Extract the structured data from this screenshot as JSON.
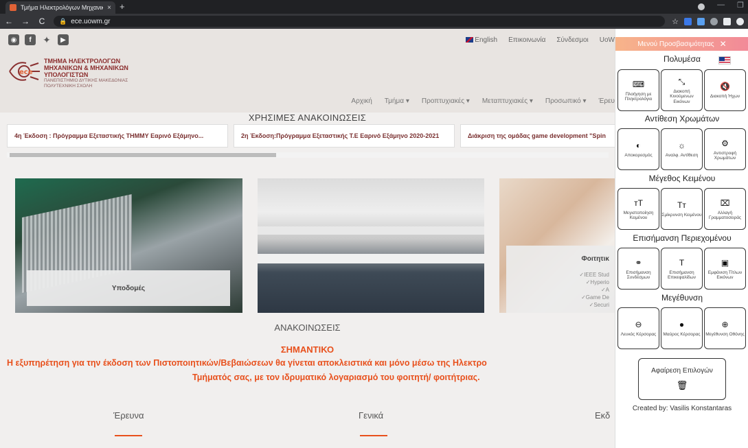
{
  "browser": {
    "tab_title": "Τμήμα Ηλεκτρολόγων Μηχανικ...",
    "tab_close": "×",
    "new_tab": "+",
    "url": "ece.uowm.gr",
    "back": "←",
    "forward": "→",
    "reload": "C"
  },
  "site": {
    "top_links": [
      "English",
      "Επικοινωνία",
      "Σύνδεσμοι",
      "UoW"
    ],
    "logo_lines": [
      "ΤΜΗΜΑ ΗΛΕΚΤΡΟΛΟΓΩΝ",
      "ΜΗΧΑΝΙΚΩΝ & ΜΗΧΑΝΙΚΩΝ",
      "ΥΠΟΛΟΓΙΣΤΩΝ"
    ],
    "logo_sub": [
      "ΠΑΝΕΠΙΣΤΗΜΙΟ ΔΥΤΙΚΗΣ ΜΑΚΕΔΟΝΙΑΣ",
      "ΠΟΛΥΤΕΧΝΙΚΗ ΣΧΟΛΗ"
    ],
    "nav": [
      "Αρχική",
      "Τμήμα ▾",
      "Προπτυχιακές ▾",
      "Μεταπτυχιακές ▾",
      "Προσωπικό ▾",
      "Έρευ"
    ],
    "useful_title": "ΧΡΗΣΙΜΕΣ ΑΝΑΚΟΙΝΩΣΕΙΣ",
    "cards": [
      "4η Έκδοση : Πρόγραμμα Εξεταστικής ΤΗΜΜΥ Εαρινό Εξάμηνο...",
      "2η Έκδοση:Πρόγραμμα Εξεταστικής Τ.Ε Εαρινό Εξάμηνο 2020-2021",
      "Διάκριση της ομάδας game development \"Spin"
    ],
    "infra_label": "Υποδομές",
    "students_label": "Φοιτητικ",
    "students_items": [
      "✓IEEE Stud",
      "✓Hyperio",
      "✓A",
      "✓Game De",
      "✓Securi"
    ],
    "announcements": "ΑΝΑΚΟΙΝΩΣΕΙΣ",
    "important": "ΣΗΜΑΝΤΙΚΟ",
    "important_line1": "Η εξυπηρέτηση για την έκδοση των Πιστοποιητικών/Βεβαιώσεων θα γίνεται αποκλειστικά και μόνο μέσω της Ηλεκτρο",
    "important_line2": "Τμήματός σας, με τον ιδρυματικό λογαριασμό του φοιτητή/ φοιτήτριας.",
    "footer_cols": [
      "Έρευνα",
      "Γενικά",
      "Εκδ"
    ]
  },
  "accessibility": {
    "title": "Μενού Προσβασιμότητας",
    "close": "✕",
    "sections": [
      "Πολυμέσα",
      "Αντίθεση Χρωμάτων",
      "Μέγεθος Κειμένου",
      "Επισήμανση Περιεχομένου",
      "Μεγέθυνση"
    ],
    "multimedia": [
      {
        "label": "Πλοήγηση με Πληκτρολόγιο",
        "icon": "⌨"
      },
      {
        "label": "Διακοπή Κινούμενων Εικόνων",
        "icon": "⤡"
      },
      {
        "label": "Διακοπή Ήχων",
        "icon": "🔇"
      }
    ],
    "contrast": [
      {
        "label": "Αποκορεσμός",
        "icon": "◐"
      },
      {
        "label": "Αναλφ. Αντίθεση",
        "icon": "☼"
      },
      {
        "label": "Αντιστροφή Χρωμάτων",
        "icon": "⚙"
      }
    ],
    "text_size": [
      {
        "label": "Μεγιστοποίηση Κειμένου",
        "icon": "ᴛT"
      },
      {
        "label": "Σμίκρυνση Κειμένου",
        "icon": "Tт"
      },
      {
        "label": "Αλλαγή Γραμματοσειράς",
        "icon": "⌧"
      }
    ],
    "highlight": [
      {
        "label": "Επισήμανση Συνδέσμων",
        "icon": "⚭"
      },
      {
        "label": "Επισήμανση Επικεφαλίδων",
        "icon": "T"
      },
      {
        "label": "Εμφάνιση Τίτλων Εικόνων",
        "icon": "▣"
      }
    ],
    "zoom": [
      {
        "label": "Λευκός Κέρσορας",
        "icon": "⊖"
      },
      {
        "label": "Μαύρος Κέρσορας",
        "icon": "●"
      },
      {
        "label": "Μεγέθυνση Οθόνης",
        "icon": "⊕"
      }
    ],
    "reset_label": "Αφαίρεση Επιλογών",
    "reset_icon": "🗑",
    "credit": "Created by: Vasilis Konstantaras"
  }
}
